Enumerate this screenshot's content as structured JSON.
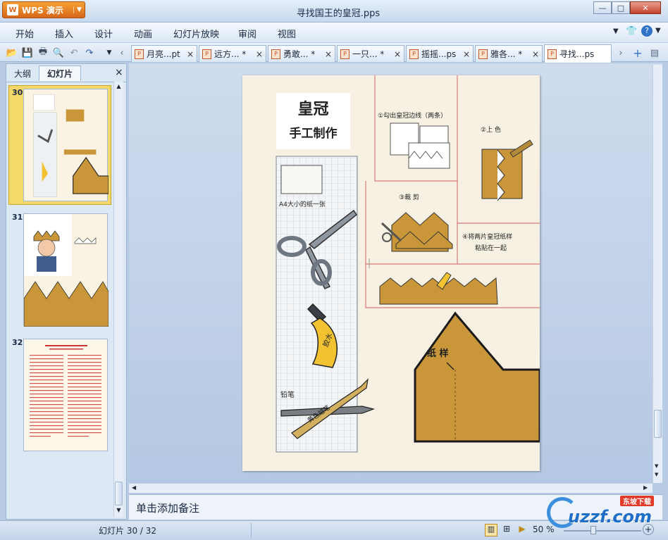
{
  "app": {
    "name": "WPS 演示",
    "window_title": "寻找国王的皇冠.pps"
  },
  "menu": [
    "开始",
    "插入",
    "设计",
    "动画",
    "幻灯片放映",
    "审阅",
    "视图"
  ],
  "doc_tabs": [
    {
      "label": "月亮...pt",
      "active": false
    },
    {
      "label": "远方... *",
      "active": false
    },
    {
      "label": "勇敢... *",
      "active": false
    },
    {
      "label": "一只... *",
      "active": false
    },
    {
      "label": "摇摇...ps",
      "active": false
    },
    {
      "label": "雅各... *",
      "active": false
    },
    {
      "label": "寻找...ps",
      "active": true
    }
  ],
  "panel": {
    "tab_outline": "大纲",
    "tab_slides": "幻灯片",
    "close": "×"
  },
  "thumbnails": [
    {
      "num": "30",
      "selected": true
    },
    {
      "num": "31",
      "selected": false
    },
    {
      "num": "32",
      "selected": false
    }
  ],
  "slide": {
    "title_line1": "皇冠",
    "title_line2": "手工制作",
    "paper_label": "A4大小的纸一张",
    "glue_label": "胶水",
    "pencil_label": "铅笔",
    "crayon_label": "黄色蜡笔",
    "step1": "①勾出皇冠边线（两条）",
    "step2": "②上  色",
    "step3": "③裁  剪",
    "step4_line1": "④将两片皇冠纸样",
    "step4_line2": "粘贴在一起",
    "template_label": "纸 样"
  },
  "notes": {
    "placeholder": "单击添加备注"
  },
  "status": {
    "slide_counter": "幻灯片 30 / 32",
    "zoom": "50 %"
  },
  "watermark": {
    "text": "uzzf.com",
    "badge": "东坡下载"
  },
  "colors": {
    "accent": "#d7661a",
    "crown": "#c9973a",
    "frame": "#9fb6d3"
  }
}
